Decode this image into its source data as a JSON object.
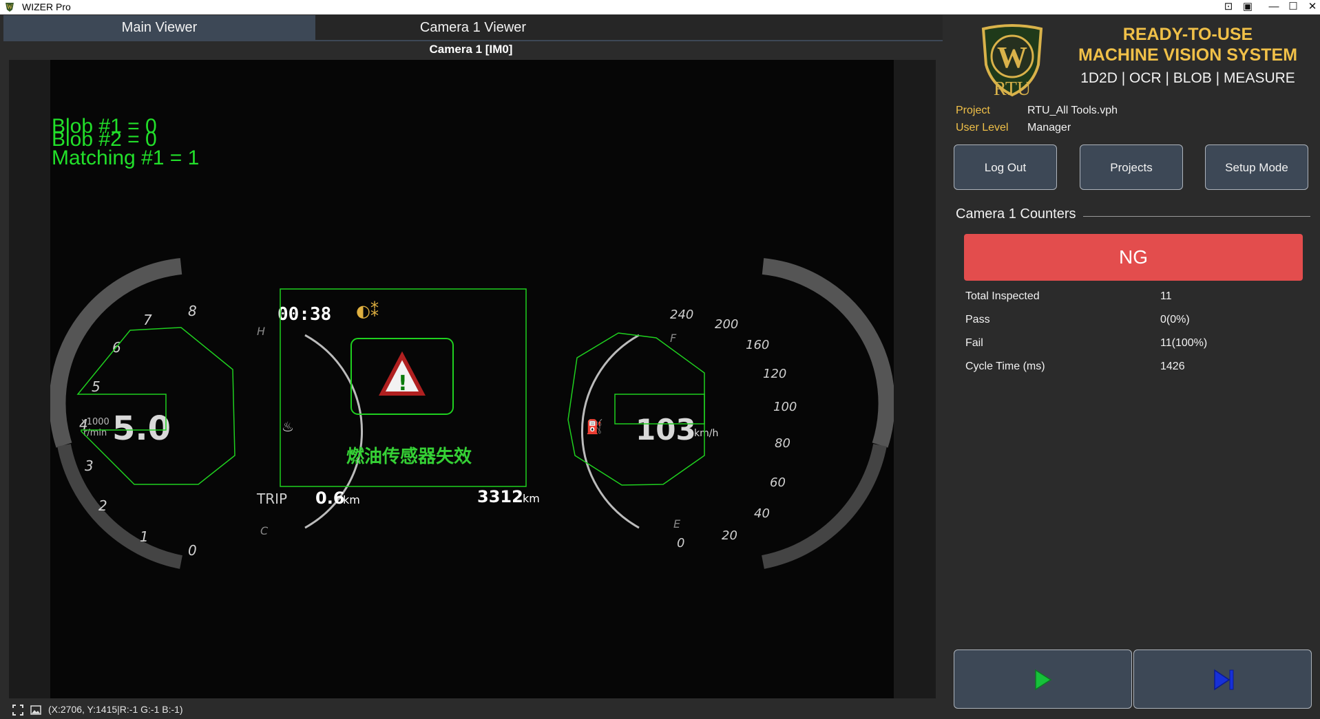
{
  "window": {
    "title": "WIZER Pro",
    "controls": [
      "pin-icon",
      "camera-icon",
      "minimize-icon",
      "maximize-icon",
      "close-icon"
    ]
  },
  "tabs": [
    {
      "label": "Main Viewer",
      "active": true
    },
    {
      "label": "Camera 1 Viewer",
      "active": false
    }
  ],
  "viewer": {
    "camera_label": "Camera 1  [IM0]",
    "overlay_lines": [
      "Blob #1 = 0",
      "Blob #2 = 0",
      "Matching #1 = 1"
    ],
    "overlay_color": "#22e02a"
  },
  "status_bar": {
    "coords": "(X:2706, Y:1415|R:-1 G:-1 B:-1)"
  },
  "brand": {
    "logo_text": "RTU",
    "headline_1": "READY-TO-USE",
    "headline_2": "MACHINE VISION SYSTEM",
    "tools": "1D2D | OCR | BLOB | MEASURE",
    "accent_color": "#f0c048"
  },
  "project_info": {
    "project_label": "Project",
    "project_value": "RTU_All Tools.vph",
    "user_label": "User Level",
    "user_value": "Manager"
  },
  "buttons": {
    "logout": "Log Out",
    "projects": "Projects",
    "setup": "Setup Mode"
  },
  "counters": {
    "title": "Camera 1 Counters",
    "result": "NG",
    "result_color": "#e34d4d",
    "rows": [
      {
        "label": "Total Inspected",
        "value": "11"
      },
      {
        "label": "Pass",
        "value": "0(0%)"
      },
      {
        "label": "Fail",
        "value": "11(100%)"
      },
      {
        "label": "Cycle Time (ms)",
        "value": "1426"
      }
    ]
  },
  "controls": {
    "run_icon": "play-icon",
    "step_icon": "step-forward-icon"
  }
}
